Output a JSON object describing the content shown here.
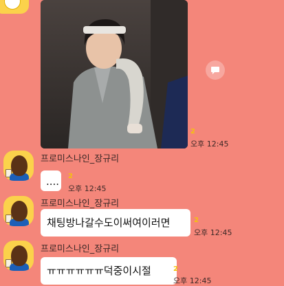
{
  "messages": [
    {
      "type": "image",
      "unread": "2",
      "time": "오후 12:45"
    },
    {
      "type": "text",
      "sender": "프로미스나인_장규리",
      "text": "....",
      "unread": "2",
      "time": "오후 12:45"
    },
    {
      "type": "text",
      "sender": "프로미스나인_장규리",
      "text": "채팅방나갈수도이써여이러면",
      "unread": "2",
      "time": "오후 12:45"
    },
    {
      "type": "text",
      "sender": "프로미스나인_장규리",
      "text": "ㅠㅠㅠㅠㅠㅠ덕중이시절",
      "unread": "2",
      "time": "오후 12:45"
    }
  ],
  "colors": {
    "background": "#f4867a",
    "bubble": "#ffffff",
    "unread": "#f4c20d"
  },
  "icons": {
    "share": "speech-bubble-icon"
  }
}
